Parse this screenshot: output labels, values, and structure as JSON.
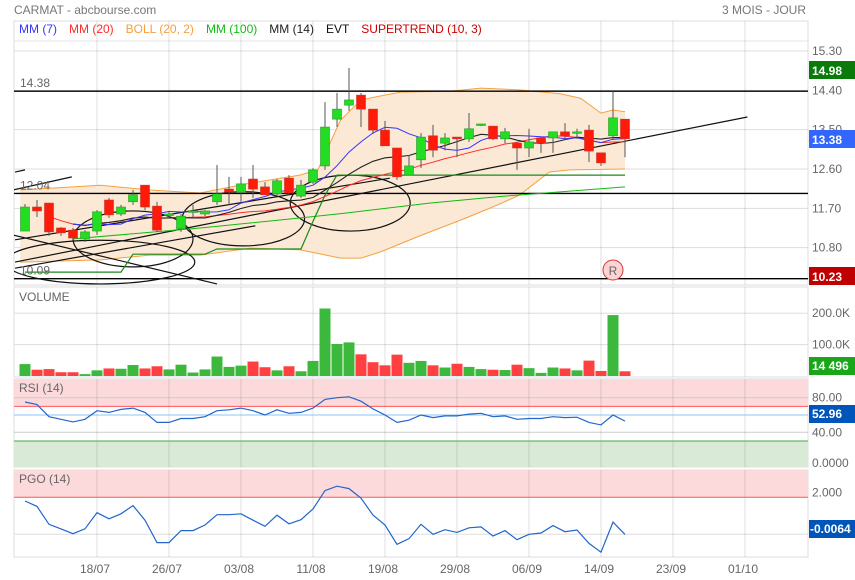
{
  "header": {
    "title": "CARMAT - abcbourse.com",
    "period": "3 MOIS - JOUR"
  },
  "legend": [
    {
      "label": "MM (7)",
      "color": "#3333ff"
    },
    {
      "label": "MM (20)",
      "color": "#ff2a2a"
    },
    {
      "label": "BOLL (20, 2)",
      "color": "#f5a040"
    },
    {
      "label": "MM (100)",
      "color": "#11bb11"
    },
    {
      "label": "MM (14)",
      "color": "#222222"
    },
    {
      "label": "EVT",
      "color": "#111111"
    },
    {
      "label": "SUPERTREND (10, 3)",
      "color": "#cc0000"
    }
  ],
  "colors": {
    "up": "#22dd22",
    "down": "#ff1a0a",
    "vol_up": "#3cb83c",
    "vol_down": "#ff4040",
    "boll_fill": "#fbe9d6",
    "boll_line": "#f5a040",
    "supertrend": "#1a8a1a"
  },
  "chart_data": {
    "type": "candlestick",
    "x_ticks": [
      {
        "label": "18/07",
        "index": 7
      },
      {
        "label": "26/07",
        "index": 13
      },
      {
        "label": "03/08",
        "index": 19
      },
      {
        "label": "11/08",
        "index": 25
      },
      {
        "label": "19/08",
        "index": 31
      },
      {
        "label": "29/08",
        "index": 37
      },
      {
        "label": "06/09",
        "index": 43
      },
      {
        "label": "14/09",
        "index": 49
      },
      {
        "label": "23/09",
        "index": 55
      },
      {
        "label": "01/10",
        "index": 61
      }
    ],
    "price": {
      "y_ticks": [
        "15.30",
        "14.40",
        "13.50",
        "12.60",
        "11.70",
        "10.80"
      ],
      "ylim": [
        10.09,
        15.5
      ],
      "candles_ohlc": [
        [
          11.18,
          11.8,
          11.18,
          11.73
        ],
        [
          11.73,
          11.89,
          11.5,
          11.64
        ],
        [
          11.82,
          11.82,
          11.07,
          11.16
        ],
        [
          11.25,
          11.27,
          11.07,
          11.14
        ],
        [
          11.2,
          11.25,
          10.98,
          11.02
        ],
        [
          11.0,
          11.2,
          10.93,
          11.16
        ],
        [
          11.18,
          11.66,
          11.09,
          11.62
        ],
        [
          11.89,
          11.94,
          11.48,
          11.55
        ],
        [
          11.57,
          11.78,
          11.52,
          11.73
        ],
        [
          11.85,
          12.12,
          11.78,
          12.01
        ],
        [
          12.23,
          12.23,
          11.66,
          11.73
        ],
        [
          11.75,
          11.85,
          11.16,
          11.2
        ],
        [
          11.55,
          11.62,
          11.5,
          11.57
        ],
        [
          11.23,
          11.57,
          11.16,
          11.52
        ],
        [
          11.62,
          11.78,
          11.48,
          11.64
        ],
        [
          11.57,
          11.66,
          11.52,
          11.64
        ],
        [
          11.85,
          12.69,
          11.78,
          12.03
        ],
        [
          12.14,
          12.42,
          11.78,
          12.07
        ],
        [
          12.07,
          12.42,
          11.85,
          12.26
        ],
        [
          12.37,
          12.69,
          11.94,
          12.14
        ],
        [
          12.19,
          12.3,
          12.01,
          12.01
        ],
        [
          12.03,
          12.37,
          11.98,
          12.33
        ],
        [
          12.39,
          12.46,
          12.01,
          12.05
        ],
        [
          11.98,
          12.35,
          11.94,
          12.23
        ],
        [
          12.3,
          12.62,
          12.26,
          12.58
        ],
        [
          12.67,
          14.13,
          12.58,
          13.56
        ],
        [
          13.74,
          14.34,
          13.56,
          13.97
        ],
        [
          14.06,
          14.91,
          13.93,
          14.18
        ],
        [
          14.29,
          14.34,
          13.56,
          13.97
        ],
        [
          13.97,
          13.97,
          13.4,
          13.49
        ],
        [
          13.49,
          13.7,
          13.13,
          13.13
        ],
        [
          13.08,
          13.08,
          12.35,
          12.42
        ],
        [
          12.46,
          12.92,
          12.46,
          12.67
        ],
        [
          12.81,
          13.42,
          12.62,
          13.33
        ],
        [
          13.36,
          13.61,
          12.87,
          13.03
        ],
        [
          13.19,
          13.42,
          13.03,
          13.31
        ],
        [
          13.33,
          13.33,
          12.87,
          13.29
        ],
        [
          13.29,
          13.88,
          13.22,
          13.52
        ],
        [
          13.61,
          13.63,
          13.58,
          13.63
        ],
        [
          13.58,
          13.58,
          13.26,
          13.29
        ],
        [
          13.29,
          13.54,
          13.19,
          13.45
        ],
        [
          13.19,
          13.22,
          12.58,
          13.08
        ],
        [
          13.08,
          13.52,
          12.87,
          13.22
        ],
        [
          13.31,
          13.33,
          12.97,
          13.19
        ],
        [
          13.31,
          13.45,
          12.97,
          13.45
        ],
        [
          13.45,
          13.65,
          13.26,
          13.36
        ],
        [
          13.45,
          13.52,
          13.29,
          13.45
        ],
        [
          13.49,
          13.61,
          12.76,
          13.01
        ],
        [
          12.97,
          12.97,
          12.67,
          12.74
        ],
        [
          13.36,
          14.38,
          13.26,
          13.77
        ],
        [
          13.74,
          13.74,
          12.87,
          13.29
        ]
      ],
      "boll_upper": [
        [
          0.6,
          12.12
        ],
        [
          7.3,
          12.23
        ],
        [
          11.4,
          12.12
        ],
        [
          15.6,
          12.05
        ],
        [
          19.8,
          12.28
        ],
        [
          23.9,
          12.46
        ],
        [
          25.4,
          12.58
        ],
        [
          27.3,
          13.72
        ],
        [
          29,
          14.18
        ],
        [
          30.6,
          14.27
        ],
        [
          32.3,
          14.36
        ],
        [
          36.4,
          14.38
        ],
        [
          39,
          14.45
        ],
        [
          42.2,
          14.41
        ],
        [
          45.6,
          14.32
        ],
        [
          47.3,
          14.22
        ],
        [
          49,
          13.88
        ],
        [
          50,
          13.95
        ],
        [
          51,
          13.91
        ]
      ],
      "boll_lower": [
        [
          0.6,
          10.47
        ],
        [
          7.3,
          10.52
        ],
        [
          11.4,
          10.63
        ],
        [
          15.6,
          10.63
        ],
        [
          19.8,
          10.79
        ],
        [
          23.9,
          10.75
        ],
        [
          27.3,
          10.56
        ],
        [
          29,
          10.56
        ],
        [
          30.6,
          10.7
        ],
        [
          33.9,
          11.07
        ],
        [
          37.3,
          11.43
        ],
        [
          39.8,
          11.71
        ],
        [
          42.2,
          12.0
        ],
        [
          44.7,
          12.53
        ],
        [
          46.4,
          12.58
        ],
        [
          51,
          12.6
        ]
      ],
      "mm100": [
        [
          5,
          11.0
        ],
        [
          15.6,
          11.25
        ],
        [
          24,
          11.48
        ],
        [
          27.7,
          11.59
        ],
        [
          34.7,
          11.82
        ],
        [
          40.6,
          11.97
        ],
        [
          51,
          12.19
        ]
      ],
      "supertrend": [
        10.24,
        10.24,
        10.24,
        10.24,
        10.24,
        10.24,
        10.24,
        10.24,
        10.24,
        10.65,
        10.65,
        10.65,
        10.65,
        10.65,
        10.65,
        10.65,
        10.77,
        10.77,
        10.77,
        10.77,
        10.77,
        10.77,
        10.77,
        10.77,
        11.4,
        12.0,
        12.46,
        12.46,
        12.46,
        12.46,
        12.46,
        12.46,
        12.46,
        12.46,
        12.46,
        12.46,
        12.46,
        12.46,
        12.46,
        12.46,
        12.46,
        12.46,
        12.46,
        12.46,
        12.46,
        12.46,
        12.46,
        12.46,
        12.46,
        12.46,
        12.46
      ],
      "levels": [
        {
          "label": "14.38",
          "value": 14.38
        },
        {
          "label": "12.04",
          "value": 12.04
        },
        {
          "label": "10.09",
          "value": 10.09
        }
      ],
      "trendlines": [
        [
          0.17,
          10.98,
          31.4,
          12.39
        ],
        [
          0.17,
          10.47,
          61.2,
          13.79
        ],
        [
          0.17,
          10.33,
          20.2,
          11.3
        ],
        [
          0.17,
          12.53,
          1.0,
          12.58
        ],
        [
          0.0,
          12.12,
          4.9,
          12.42
        ],
        [
          0.0,
          11.09,
          17.0,
          9.97
        ]
      ],
      "ellipses": [
        [
          10,
          11.0,
          5,
          0.64
        ],
        [
          19.2,
          11.46,
          5.1,
          0.62
        ],
        [
          28.1,
          11.82,
          5,
          0.64
        ],
        [
          7.25,
          10.47,
          7.9,
          0.5
        ]
      ],
      "event_marker": {
        "label": "R",
        "index": 50
      },
      "badges": [
        {
          "label": "14.98",
          "value": 14.98,
          "color": "#0a7a0a"
        },
        {
          "label": "13.38",
          "value": 13.38,
          "color": "#3366ff"
        },
        {
          "label": "10.23",
          "value": 10.09,
          "color": "#c00000"
        }
      ]
    },
    "volume": {
      "title": "VOLUME",
      "unit": "K",
      "y_ticks": [
        {
          "label": "200.0K",
          "value": 200
        },
        {
          "label": "100.0K",
          "value": 100
        }
      ],
      "values": [
        38,
        20,
        22,
        12,
        12,
        6,
        18,
        24,
        23,
        35,
        24,
        31,
        21,
        36,
        11,
        21,
        62,
        29,
        33,
        46,
        28,
        18,
        31,
        15,
        48,
        215,
        102,
        107,
        69,
        44,
        34,
        68,
        42,
        48,
        34,
        27,
        39,
        29,
        22,
        20,
        19,
        36,
        25,
        10,
        27,
        24,
        18,
        49,
        16,
        194,
        15
      ],
      "up": [
        1,
        0,
        0,
        0,
        0,
        1,
        1,
        0,
        1,
        1,
        0,
        0,
        1,
        1,
        1,
        1,
        1,
        1,
        1,
        0,
        0,
        1,
        0,
        1,
        1,
        1,
        1,
        1,
        0,
        0,
        0,
        0,
        1,
        1,
        0,
        1,
        0,
        1,
        1,
        0,
        1,
        0,
        1,
        1,
        1,
        0,
        1,
        0,
        0,
        1,
        0
      ],
      "badge": {
        "label": "14 496",
        "color": "#19a719"
      }
    },
    "rsi": {
      "title": "RSI (14)",
      "y_ticks": [
        {
          "label": "80.00",
          "value": 80
        },
        {
          "label": "40.00",
          "value": 40
        },
        {
          "label": "0.0000",
          "value": 0
        }
      ],
      "overbought": 70,
      "oversold": 30,
      "values": [
        75,
        72,
        58,
        55,
        52,
        55,
        65,
        63,
        66.5,
        68,
        63,
        51.5,
        51.5,
        56,
        56,
        58,
        65,
        66,
        68,
        65,
        60,
        66,
        62,
        63,
        68,
        78,
        80,
        81,
        76,
        67,
        60,
        51.5,
        54,
        60,
        57,
        59,
        59,
        61,
        62,
        58,
        59,
        55,
        56,
        56,
        58,
        57,
        57.5,
        51.5,
        48.5,
        60,
        53
      ],
      "badge": {
        "label": "52.96",
        "value": 60,
        "color": "#0055bb"
      }
    },
    "pgo": {
      "title": "PGO (14)",
      "y_ticks": [
        {
          "label": "2.000",
          "value": 2
        }
      ],
      "overbought": 2,
      "values": [
        1.8,
        1.51,
        0.54,
        0.29,
        0.03,
        0.3,
        1.17,
        0.84,
        1.11,
        1.55,
        0.76,
        -0.45,
        -0.45,
        0.2,
        0.2,
        0.5,
        1.06,
        1.06,
        1.11,
        0.76,
        0.43,
        1.03,
        0.57,
        0.79,
        1.37,
        2.36,
        2.6,
        2.47,
        1.95,
        1.04,
        0.5,
        -0.54,
        -0.24,
        0.54,
        0.0,
        0.25,
        0.1,
        0.35,
        0.4,
        -0.1,
        0.2,
        -0.29,
        0,
        0.07,
        0.47,
        0.14,
        0.23,
        -0.49,
        -0.97,
        0.66,
        -0.0064
      ],
      "badge": {
        "label": "-0.0064",
        "value": -0.0064,
        "color": "#0055bb"
      }
    }
  }
}
